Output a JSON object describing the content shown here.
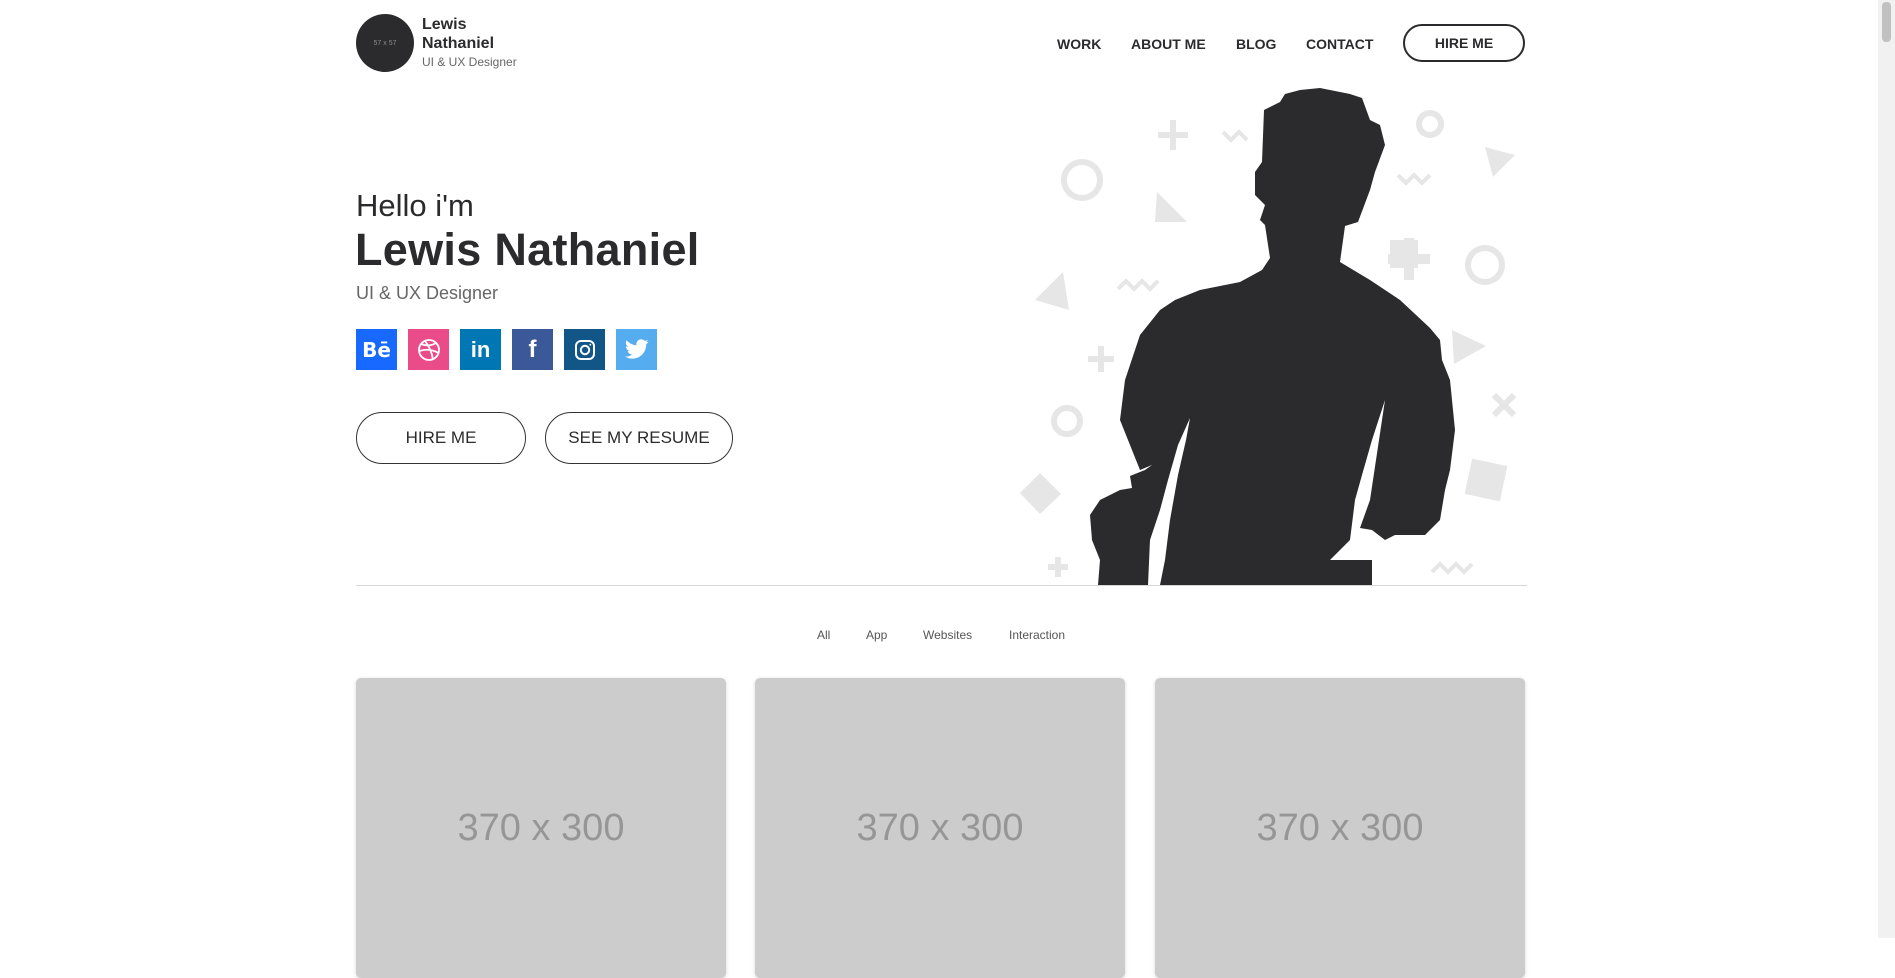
{
  "header": {
    "avatar_text": "57 x 57",
    "name": "Lewis Nathaniel",
    "role": "UI & UX Designer",
    "nav": [
      "WORK",
      "ABOUT ME",
      "BLOG",
      "CONTACT"
    ],
    "cta": "HIRE ME"
  },
  "hero": {
    "greeting": "Hello i'm",
    "name": "Lewis Nathaniel",
    "role": "UI & UX Designer",
    "social": [
      {
        "icon": "behance-icon",
        "color": "#1769ff"
      },
      {
        "icon": "dribbble-icon",
        "color": "#ea4c89"
      },
      {
        "icon": "linkedin-icon",
        "color": "#0077b5"
      },
      {
        "icon": "facebook-icon",
        "color": "#3b5998"
      },
      {
        "icon": "instagram-icon",
        "color": "#125688"
      },
      {
        "icon": "twitter-icon",
        "color": "#55acee"
      }
    ],
    "primary_button": "HIRE ME",
    "secondary_button": "SEE MY RESUME"
  },
  "filters": [
    "All",
    "App",
    "Websites",
    "Interaction"
  ],
  "portfolio": [
    {
      "placeholder": "370 x 300"
    },
    {
      "placeholder": "370 x 300"
    },
    {
      "placeholder": "370 x 300"
    }
  ],
  "colors": {
    "text": "#2b2b2d",
    "muted": "#666666",
    "card_bg": "#cccccc",
    "decor": "#e6e6e6"
  }
}
